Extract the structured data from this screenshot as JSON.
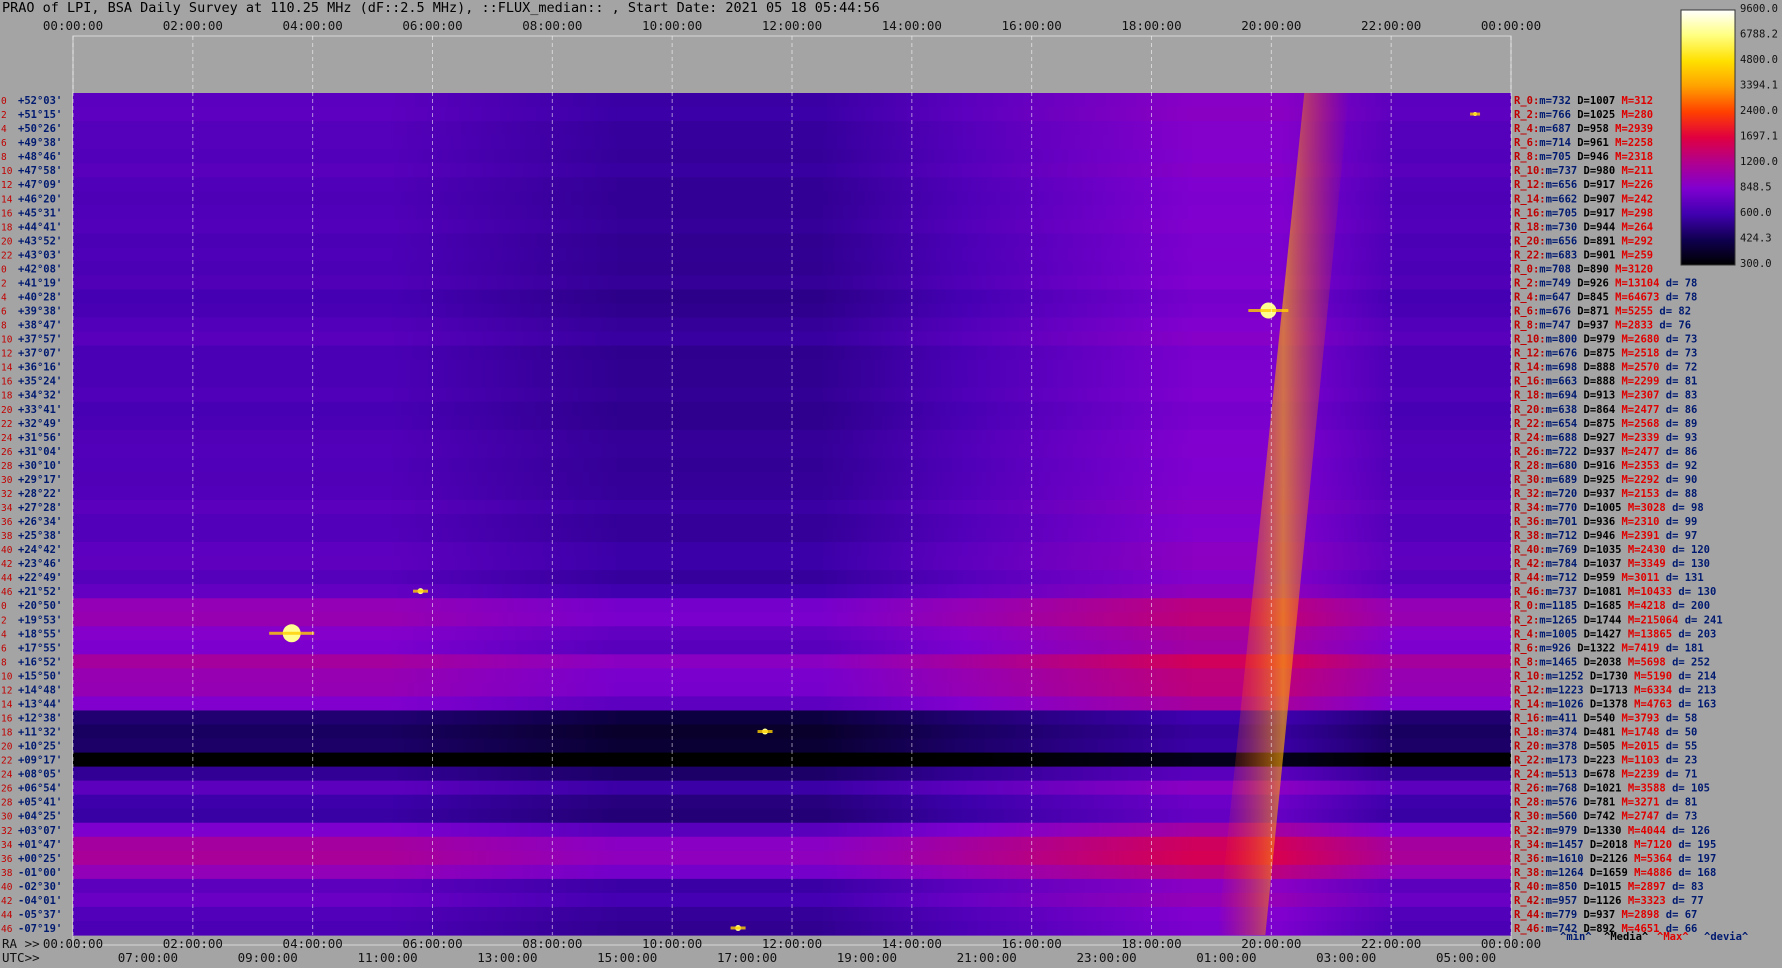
{
  "title": "PRAO of LPI, BSA Daily Survey at 110.25 MHz (dF::2.5 MHz), ::FLUX_median:: , Start Date: 2021 05 18 05:44:56",
  "axes": {
    "top_ticks": [
      "00:00:00",
      "02:00:00",
      "04:00:00",
      "06:00:00",
      "08:00:00",
      "10:00:00",
      "12:00:00",
      "14:00:00",
      "16:00:00",
      "18:00:00",
      "20:00:00",
      "22:00:00",
      "00:00:00"
    ],
    "bottom_ra_prefix": "RA >>",
    "bottom_ra_ticks": [
      "00:00:00",
      "02:00:00",
      "04:00:00",
      "06:00:00",
      "08:00:00",
      "10:00:00",
      "12:00:00",
      "14:00:00",
      "16:00:00",
      "18:00:00",
      "20:00:00",
      "22:00:00",
      "00:00:00"
    ],
    "bottom_utc_prefix": "UTC>>",
    "bottom_utc_ticks": [
      "07:00:00",
      "09:00:00",
      "11:00:00",
      "13:00:00",
      "15:00:00",
      "17:00:00",
      "19:00:00",
      "21:00:00",
      "23:00:00",
      "01:00:00",
      "03:00:00",
      "05:00:00"
    ]
  },
  "colorbar": {
    "labels": [
      "9600.0",
      "6788.2",
      "4800.0",
      "3394.1",
      "2400.0",
      "1697.1",
      "1200.0",
      "848.5",
      "600.0",
      "424.3",
      "300.0"
    ],
    "gradient": [
      "#ffffff",
      "#ffff80",
      "#ffe000",
      "#ffa000",
      "#ff4000",
      "#e00040",
      "#b00090",
      "#8000d0",
      "#4000b0",
      "#100050",
      "#000000"
    ]
  },
  "stats_legend": [
    "^min^",
    "^Media^",
    "^Max^",
    "^devia^"
  ],
  "chart_data": {
    "type": "heatmap",
    "x_range_hours_lst": [
      0,
      24
    ],
    "color_scale_range": [
      300.0,
      9600.0
    ],
    "rows": [
      {
        "idx": "0",
        "dec": "+52°03'",
        "min": "732",
        "med": "1007",
        "max": "312",
        "dev": ""
      },
      {
        "idx": "2",
        "dec": "+51°15'",
        "min": "766",
        "med": "1025",
        "max": "280",
        "dev": ""
      },
      {
        "idx": "4",
        "dec": "+50°26'",
        "min": "687",
        "med": "958",
        "max": "2939",
        "dev": ""
      },
      {
        "idx": "6",
        "dec": "+49°38'",
        "min": "714",
        "med": "961",
        "max": "2258",
        "dev": ""
      },
      {
        "idx": "8",
        "dec": "+48°46'",
        "min": "705",
        "med": "946",
        "max": "2318",
        "dev": ""
      },
      {
        "idx": "10",
        "dec": "+47°58'",
        "min": "737",
        "med": "980",
        "max": "211",
        "dev": ""
      },
      {
        "idx": "12",
        "dec": "+47°09'",
        "min": "656",
        "med": "917",
        "max": "226",
        "dev": ""
      },
      {
        "idx": "14",
        "dec": "+46°20'",
        "min": "662",
        "med": "907",
        "max": "242",
        "dev": ""
      },
      {
        "idx": "16",
        "dec": "+45°31'",
        "min": "705",
        "med": "917",
        "max": "298",
        "dev": ""
      },
      {
        "idx": "18",
        "dec": "+44°41'",
        "min": "730",
        "med": "944",
        "max": "264",
        "dev": ""
      },
      {
        "idx": "20",
        "dec": "+43°52'",
        "min": "656",
        "med": "891",
        "max": "292",
        "dev": ""
      },
      {
        "idx": "22",
        "dec": "+43°03'",
        "min": "683",
        "med": "901",
        "max": "259",
        "dev": ""
      },
      {
        "idx": "0",
        "dec": "+42°08'",
        "min": "708",
        "med": "890",
        "max": "3120",
        "dev": ""
      },
      {
        "idx": "2",
        "dec": "+41°19'",
        "min": "749",
        "med": "926",
        "max": "13104",
        "dev": "78"
      },
      {
        "idx": "4",
        "dec": "+40°28'",
        "min": "647",
        "med": "845",
        "max": "64673",
        "dev": "78"
      },
      {
        "idx": "6",
        "dec": "+39°38'",
        "min": "676",
        "med": "871",
        "max": "5255",
        "dev": "82"
      },
      {
        "idx": "8",
        "dec": "+38°47'",
        "min": "747",
        "med": "937",
        "max": "2833",
        "dev": "76"
      },
      {
        "idx": "10",
        "dec": "+37°57'",
        "min": "800",
        "med": "979",
        "max": "2680",
        "dev": "73"
      },
      {
        "idx": "12",
        "dec": "+37°07'",
        "min": "676",
        "med": "875",
        "max": "2518",
        "dev": "73"
      },
      {
        "idx": "14",
        "dec": "+36°16'",
        "min": "698",
        "med": "888",
        "max": "2570",
        "dev": "72"
      },
      {
        "idx": "16",
        "dec": "+35°24'",
        "min": "663",
        "med": "888",
        "max": "2299",
        "dev": "81"
      },
      {
        "idx": "18",
        "dec": "+34°32'",
        "min": "694",
        "med": "913",
        "max": "2307",
        "dev": "83"
      },
      {
        "idx": "20",
        "dec": "+33°41'",
        "min": "638",
        "med": "864",
        "max": "2477",
        "dev": "86"
      },
      {
        "idx": "22",
        "dec": "+32°49'",
        "min": "654",
        "med": "875",
        "max": "2568",
        "dev": "89"
      },
      {
        "idx": "24",
        "dec": "+31°56'",
        "min": "688",
        "med": "927",
        "max": "2339",
        "dev": "93"
      },
      {
        "idx": "26",
        "dec": "+31°04'",
        "min": "722",
        "med": "937",
        "max": "2477",
        "dev": "86"
      },
      {
        "idx": "28",
        "dec": "+30°10'",
        "min": "680",
        "med": "916",
        "max": "2353",
        "dev": "92"
      },
      {
        "idx": "30",
        "dec": "+29°17'",
        "min": "689",
        "med": "925",
        "max": "2292",
        "dev": "90"
      },
      {
        "idx": "32",
        "dec": "+28°22'",
        "min": "720",
        "med": "937",
        "max": "2153",
        "dev": "88"
      },
      {
        "idx": "34",
        "dec": "+27°28'",
        "min": "770",
        "med": "1005",
        "max": "3028",
        "dev": "98"
      },
      {
        "idx": "36",
        "dec": "+26°34'",
        "min": "701",
        "med": "936",
        "max": "2310",
        "dev": "99"
      },
      {
        "idx": "38",
        "dec": "+25°38'",
        "min": "712",
        "med": "946",
        "max": "2391",
        "dev": "97"
      },
      {
        "idx": "40",
        "dec": "+24°42'",
        "min": "769",
        "med": "1035",
        "max": "2430",
        "dev": "120"
      },
      {
        "idx": "42",
        "dec": "+23°46'",
        "min": "784",
        "med": "1037",
        "max": "3349",
        "dev": "130"
      },
      {
        "idx": "44",
        "dec": "+22°49'",
        "min": "712",
        "med": "959",
        "max": "3011",
        "dev": "131"
      },
      {
        "idx": "46",
        "dec": "+21°52'",
        "min": "737",
        "med": "1081",
        "max": "10433",
        "dev": "130"
      },
      {
        "idx": "0",
        "dec": "+20°50'",
        "min": "1185",
        "med": "1685",
        "max": "4218",
        "dev": "200"
      },
      {
        "idx": "2",
        "dec": "+19°53'",
        "min": "1265",
        "med": "1744",
        "max": "215064",
        "dev": "241"
      },
      {
        "idx": "4",
        "dec": "+18°55'",
        "min": "1005",
        "med": "1427",
        "max": "13865",
        "dev": "203"
      },
      {
        "idx": "6",
        "dec": "+17°55'",
        "min": "926",
        "med": "1322",
        "max": "7419",
        "dev": "181"
      },
      {
        "idx": "8",
        "dec": "+16°52'",
        "min": "1465",
        "med": "2038",
        "max": "5698",
        "dev": "252"
      },
      {
        "idx": "10",
        "dec": "+15°50'",
        "min": "1252",
        "med": "1730",
        "max": "5190",
        "dev": "214"
      },
      {
        "idx": "12",
        "dec": "+14°48'",
        "min": "1223",
        "med": "1713",
        "max": "6334",
        "dev": "213"
      },
      {
        "idx": "14",
        "dec": "+13°44'",
        "min": "1026",
        "med": "1378",
        "max": "4763",
        "dev": "163"
      },
      {
        "idx": "16",
        "dec": "+12°38'",
        "min": "411",
        "med": "540",
        "max": "3793",
        "dev": "58"
      },
      {
        "idx": "18",
        "dec": "+11°32'",
        "min": "374",
        "med": "481",
        "max": "1748",
        "dev": "50"
      },
      {
        "idx": "20",
        "dec": "+10°25'",
        "min": "378",
        "med": "505",
        "max": "2015",
        "dev": "55"
      },
      {
        "idx": "22",
        "dec": "+09°17'",
        "min": "173",
        "med": "223",
        "max": "1103",
        "dev": "23"
      },
      {
        "idx": "24",
        "dec": "+08°05'",
        "min": "513",
        "med": "678",
        "max": "2239",
        "dev": "71"
      },
      {
        "idx": "26",
        "dec": "+06°54'",
        "min": "768",
        "med": "1021",
        "max": "3588",
        "dev": "105"
      },
      {
        "idx": "28",
        "dec": "+05°41'",
        "min": "576",
        "med": "781",
        "max": "3271",
        "dev": "81"
      },
      {
        "idx": "30",
        "dec": "+04°25'",
        "min": "560",
        "med": "742",
        "max": "2747",
        "dev": "73"
      },
      {
        "idx": "32",
        "dec": "+03°07'",
        "min": "979",
        "med": "1330",
        "max": "4044",
        "dev": "126"
      },
      {
        "idx": "34",
        "dec": "+01°47'",
        "min": "1457",
        "med": "2018",
        "max": "7120",
        "dev": "195"
      },
      {
        "idx": "36",
        "dec": "+00°25'",
        "min": "1610",
        "med": "2126",
        "max": "5364",
        "dev": "197"
      },
      {
        "idx": "38",
        "dec": "-01°00'",
        "min": "1264",
        "med": "1659",
        "max": "4886",
        "dev": "168"
      },
      {
        "idx": "40",
        "dec": "-02°30'",
        "min": "850",
        "med": "1015",
        "max": "2897",
        "dev": "83"
      },
      {
        "idx": "42",
        "dec": "-04°01'",
        "min": "957",
        "med": "1126",
        "max": "3323",
        "dev": "77"
      },
      {
        "idx": "44",
        "dec": "-05°37'",
        "min": "779",
        "med": "937",
        "max": "2898",
        "dev": "67"
      },
      {
        "idx": "46",
        "dec": "-07°19'",
        "min": "742",
        "med": "892",
        "max": "4651",
        "dev": "66"
      }
    ]
  }
}
